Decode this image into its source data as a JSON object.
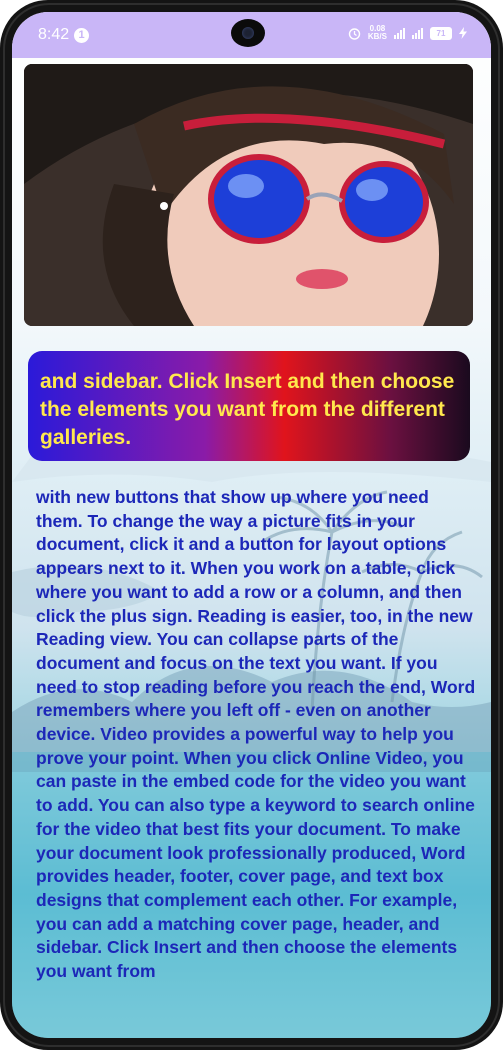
{
  "status_bar": {
    "time": "8:42",
    "notification_count": "1",
    "net_speed_value": "0.08",
    "net_speed_unit": "KB/S",
    "battery": "71"
  },
  "banner": {
    "text": "and sidebar. Click Insert and then choose the elements you want from the different galleries."
  },
  "article": {
    "text": "with new buttons that show up where you need them. To change the way a picture fits in your document, click it and a button for layout options appears next to it. When you work on a table, click where you want to add a row or a column, and then click the plus sign. Reading is easier, too, in the new Reading view. You can collapse parts of the document and focus on the text you want. If you need to stop reading before you reach the end, Word remembers where you left off - even on another device. Video provides a powerful way to help you prove your point. When you click Online Video, you can paste in the embed code for the video you want to add. You can also type a keyword to search online for the video that best fits your document. To make your document look professionally produced, Word provides header, footer, cover page, and text box designs that complement each other. For example, you can add a matching cover page, header, and sidebar. Click Insert and then choose the elements you want from"
  },
  "colors": {
    "status_bar": "#c9b6f7",
    "banner_text": "#ffe84d",
    "body_text": "#1c27b8"
  },
  "icons": [
    "alarm-icon",
    "signal-icon",
    "battery-icon",
    "charging-icon",
    "front-camera"
  ]
}
